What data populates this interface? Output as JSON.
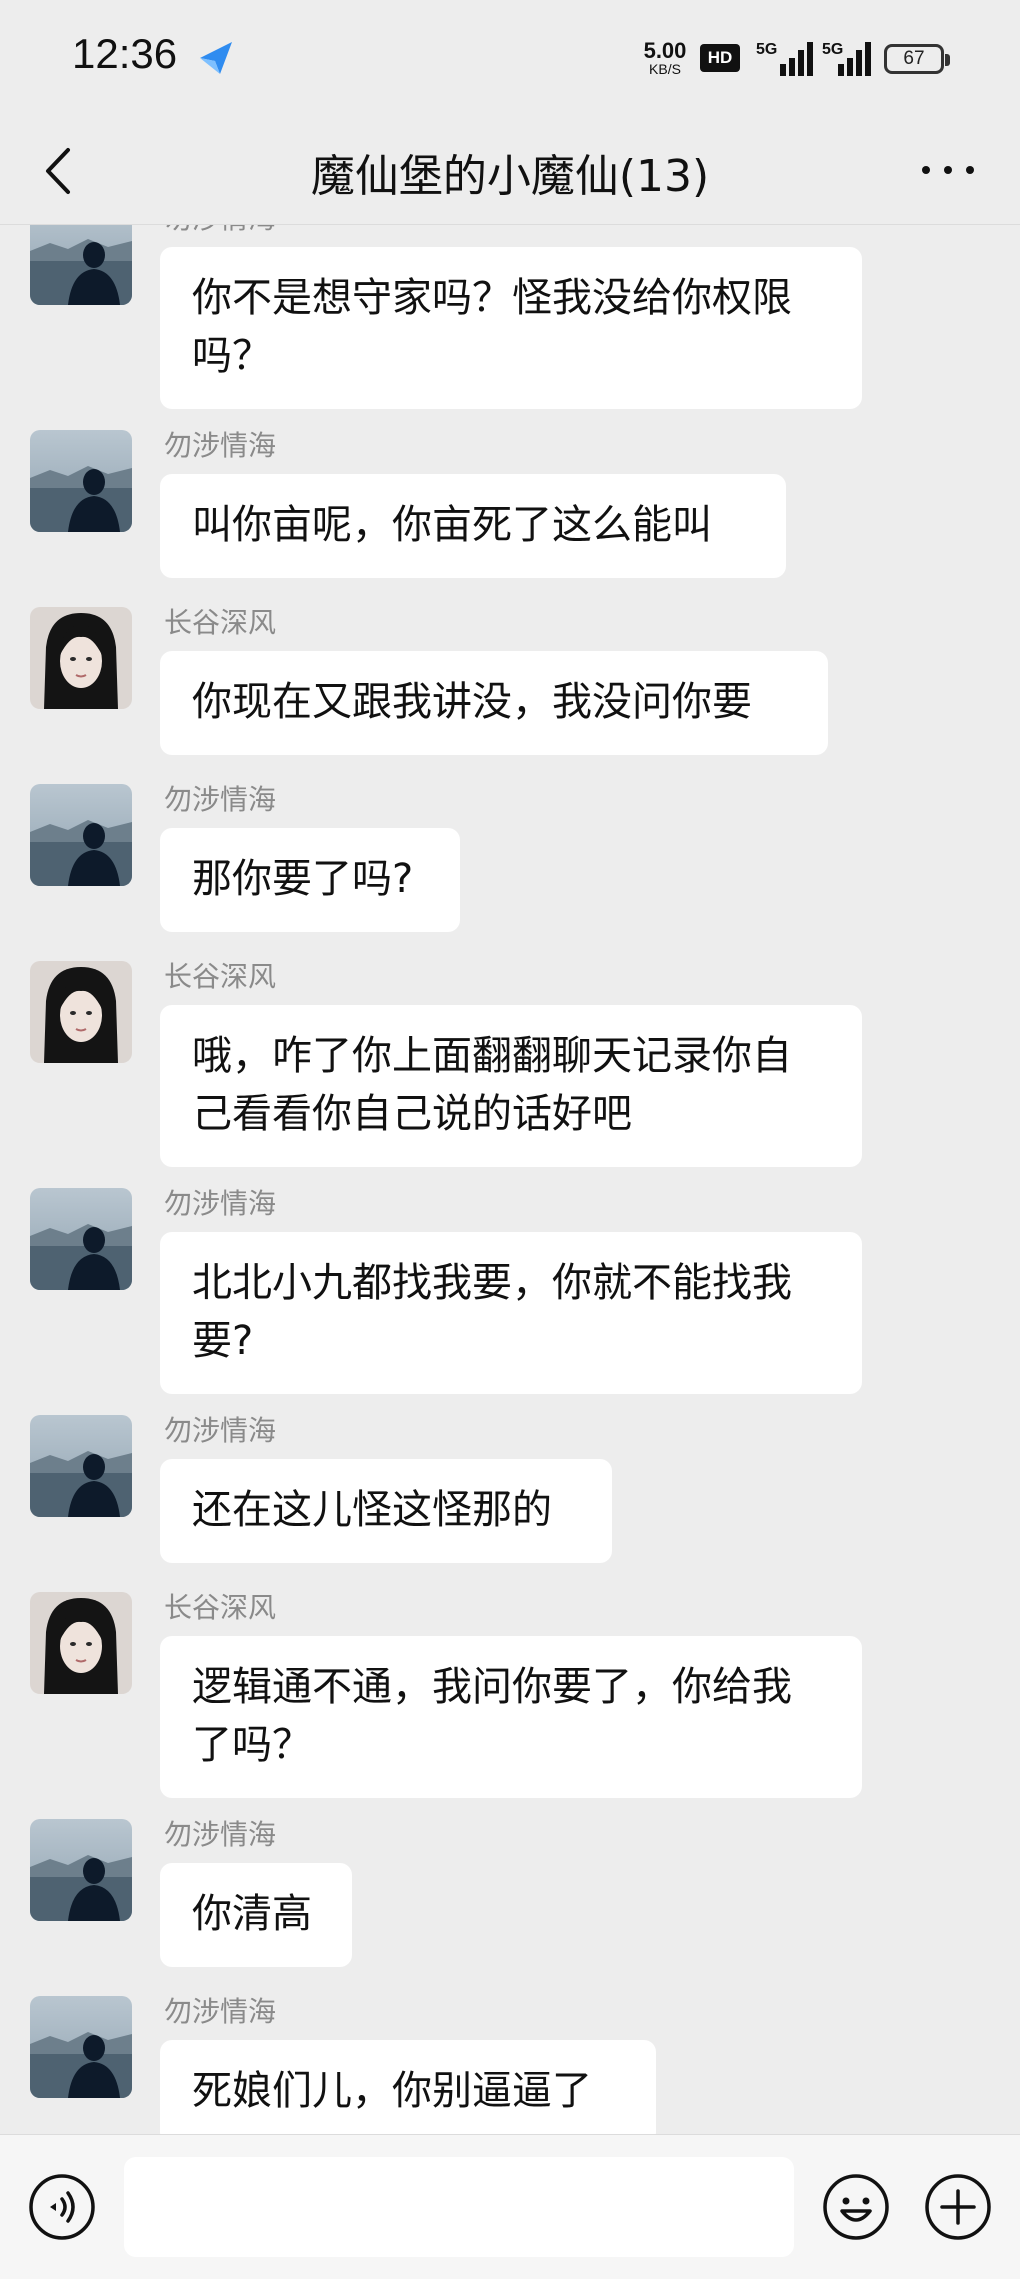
{
  "status_bar": {
    "time": "12:36",
    "net_speed_value": "5.00",
    "net_speed_unit": "KB/S",
    "hd_badge": "HD",
    "signal_1": "5G",
    "signal_2": "5G",
    "battery": "67"
  },
  "header": {
    "title": "魔仙堡的小魔仙(13)",
    "back_icon": "chevron-left-icon",
    "more_icon": "more-dots-icon"
  },
  "messages": [
    {
      "sender": "勿涉情海",
      "avatar": "landscape",
      "lines": [
        "你不是想守家吗？怪我没给你权限",
        "吗？"
      ]
    },
    {
      "sender": "勿涉情海",
      "avatar": "landscape",
      "lines": [
        "叫你亩呢，你亩死了这么能叫"
      ]
    },
    {
      "sender": "长谷深风",
      "avatar": "girl",
      "lines": [
        "你现在又跟我讲没，我没问你要"
      ]
    },
    {
      "sender": "勿涉情海",
      "avatar": "landscape",
      "lines": [
        "那你要了吗?"
      ]
    },
    {
      "sender": "长谷深风",
      "avatar": "girl",
      "lines": [
        "哦，咋了你上面翻翻聊天记录你自",
        "己看看你自己说的话好吧"
      ]
    },
    {
      "sender": "勿涉情海",
      "avatar": "landscape",
      "lines": [
        "北北小九都找我要，你就不能找我",
        "要?"
      ]
    },
    {
      "sender": "勿涉情海",
      "avatar": "landscape",
      "lines": [
        "还在这儿怪这怪那的"
      ]
    },
    {
      "sender": "长谷深风",
      "avatar": "girl",
      "lines": [
        "逻辑通不通，我问你要了，你给我",
        "了吗？"
      ]
    },
    {
      "sender": "勿涉情海",
      "avatar": "landscape",
      "lines": [
        "你清高"
      ]
    },
    {
      "sender": "勿涉情海",
      "avatar": "landscape",
      "lines": [
        "死娘们儿，你别逼逼了"
      ]
    }
  ],
  "input_bar": {
    "voice_icon": "voice-icon",
    "emoji_icon": "emoji-icon",
    "plus_icon": "plus-icon",
    "placeholder": ""
  }
}
